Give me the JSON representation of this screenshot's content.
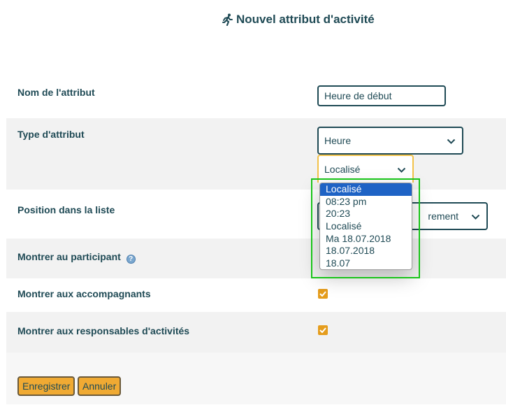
{
  "page": {
    "title": "Nouvel attribut d'activité",
    "title_icon": "running-person-icon"
  },
  "form": {
    "name": {
      "label": "Nom de l'attribut",
      "value": "Heure de début"
    },
    "type": {
      "label": "Type d'attribut",
      "value": "Heure",
      "format_value": "Localisé"
    },
    "position": {
      "label": "Position dans la liste",
      "value_fragment": "rement"
    },
    "show_participant": {
      "label": "Montrer au participant",
      "help_icon": "question-icon"
    },
    "show_companions": {
      "label": "Montrer aux accompagnants",
      "checked": true
    },
    "show_managers": {
      "label": "Montrer aux responsables d'activités",
      "checked": true
    }
  },
  "format_dropdown": {
    "options": [
      "Localisé",
      "08:23 pm",
      "20:23",
      "Localisé",
      "Ma 18.07.2018",
      "18.07.2018",
      "18.07"
    ],
    "selected_index": 0
  },
  "actions": {
    "save": "Enregistrer",
    "cancel": "Annuler"
  },
  "colors": {
    "text": "#1f4a55",
    "accent": "#f0aa33",
    "checkbox": "#e59d1d",
    "selected_option": "#1e63c5",
    "highlight": "#18c418"
  }
}
